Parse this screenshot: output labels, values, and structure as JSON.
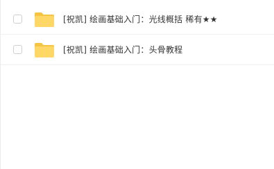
{
  "file_list": {
    "items": [
      {
        "name": "[祝凯] 绘画基础入门：光线概括 稀有★★",
        "icon": "folder-icon",
        "selected": false
      },
      {
        "name": "[祝凯] 绘画基础入门：头骨教程",
        "icon": "folder-icon",
        "selected": false
      }
    ]
  },
  "colors": {
    "folder_body": "#FFD766",
    "folder_tab": "#F6C343",
    "row_divider": "#F0F0F0",
    "text": "#333333",
    "checkbox_border": "#CFCFCF"
  }
}
